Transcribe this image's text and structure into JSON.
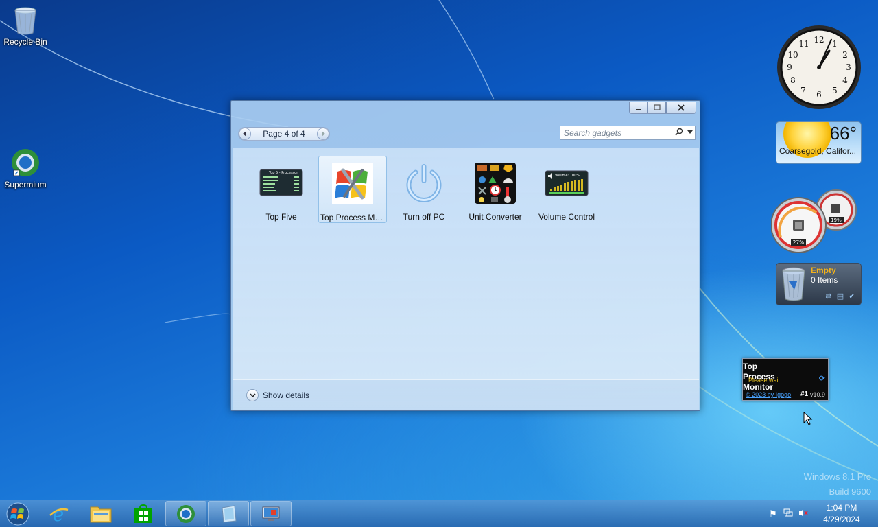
{
  "desktop": {
    "icons": [
      {
        "label": "Recycle Bin"
      },
      {
        "label": "Supermium"
      }
    ],
    "watermark": {
      "line1": "Windows 8.1 Pro",
      "line2": "Build 9600"
    }
  },
  "gallery": {
    "pager_text": "Page 4 of 4",
    "search_placeholder": "Search gadgets",
    "gadgets": [
      {
        "name": "Top Five",
        "selected": false
      },
      {
        "name": "Top Process Mo...",
        "selected": true
      },
      {
        "name": "Turn off PC",
        "selected": false
      },
      {
        "name": "Unit Converter",
        "selected": false
      },
      {
        "name": "Volume Control",
        "selected": false
      }
    ],
    "show_details_label": "Show details",
    "thumb_text": {
      "top_five_title": "Top 5 - Processor",
      "volume_title": "Volume: 100%"
    }
  },
  "sidebar": {
    "clock": {
      "hour": 1,
      "minute": 4
    },
    "weather": {
      "temp": "66°",
      "location": "Coarsegold, Califor..."
    },
    "meter": {
      "cpu": "27%",
      "ram": "19%"
    },
    "recycle": {
      "state": "Empty",
      "count": "0 Items"
    },
    "top_process_monitor": {
      "title": "Top Process Monitor",
      "status": "Please wait...",
      "copyright": "© 2023 by Igogo",
      "rank": "#1",
      "version": "v10.9"
    }
  },
  "taskbar": {
    "time": "1:04 PM",
    "date": "4/29/2024"
  },
  "colors": {
    "accent": "#1a78d8",
    "recycle_state": "#f3b21b",
    "tpm_status": "#e6c021"
  }
}
